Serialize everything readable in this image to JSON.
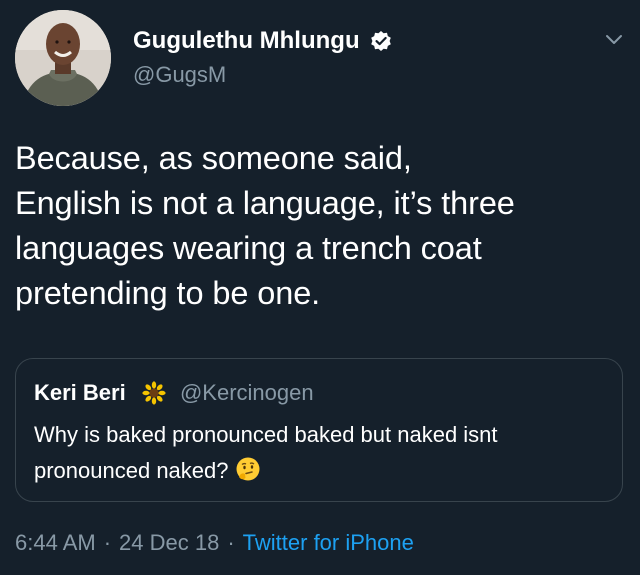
{
  "colors": {
    "background": "#15202b",
    "text_primary": "#ffffff",
    "text_secondary": "#8899a6",
    "link": "#1da1f2",
    "border": "#38444d"
  },
  "author": {
    "display_name": "Gugulethu Mhlungu",
    "handle": "@GugsM",
    "verified_icon": "verified-badge-icon",
    "avatar_icon": "avatar-photo"
  },
  "tweet": {
    "text": "Because, as someone said,\nEnglish is not a language, it’s three\nlanguages wearing a trench coat\npretending to be one."
  },
  "quote": {
    "display_name": "Keri Beri",
    "emoji_icon": "sunflower-icon",
    "handle": "@Kercinogen",
    "text_line1": "Why is baked pronounced baked but naked isnt",
    "text_line2": "pronounced naked?",
    "trailing_emoji_icon": "thinking-face-icon"
  },
  "footer": {
    "time": "6:44 AM",
    "date": "24 Dec 18",
    "separator": "·",
    "source": "Twitter for iPhone"
  }
}
